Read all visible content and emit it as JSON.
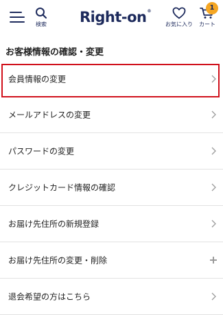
{
  "header": {
    "search_label": "検索",
    "logo_text": "Right-on",
    "logo_mark": "®",
    "favorites_label": "お気に入り",
    "cart_label": "カート",
    "cart_count": "1"
  },
  "page": {
    "title": "お客様情報の確認・変更"
  },
  "menu": {
    "items": [
      {
        "label": "会員情報の変更",
        "indicator": "chevron"
      },
      {
        "label": "メールアドレスの変更",
        "indicator": "chevron"
      },
      {
        "label": "パスワードの変更",
        "indicator": "chevron"
      },
      {
        "label": "クレジットカード情報の確認",
        "indicator": "chevron"
      },
      {
        "label": "お届け先住所の新規登録",
        "indicator": "chevron"
      },
      {
        "label": "お届け先住所の変更・削除",
        "indicator": "plus"
      },
      {
        "label": "退会希望の方はこちら",
        "indicator": "chevron"
      }
    ]
  },
  "colors": {
    "brand": "#1d2a5c",
    "badge": "#f5a623",
    "highlight": "#d0101b"
  }
}
